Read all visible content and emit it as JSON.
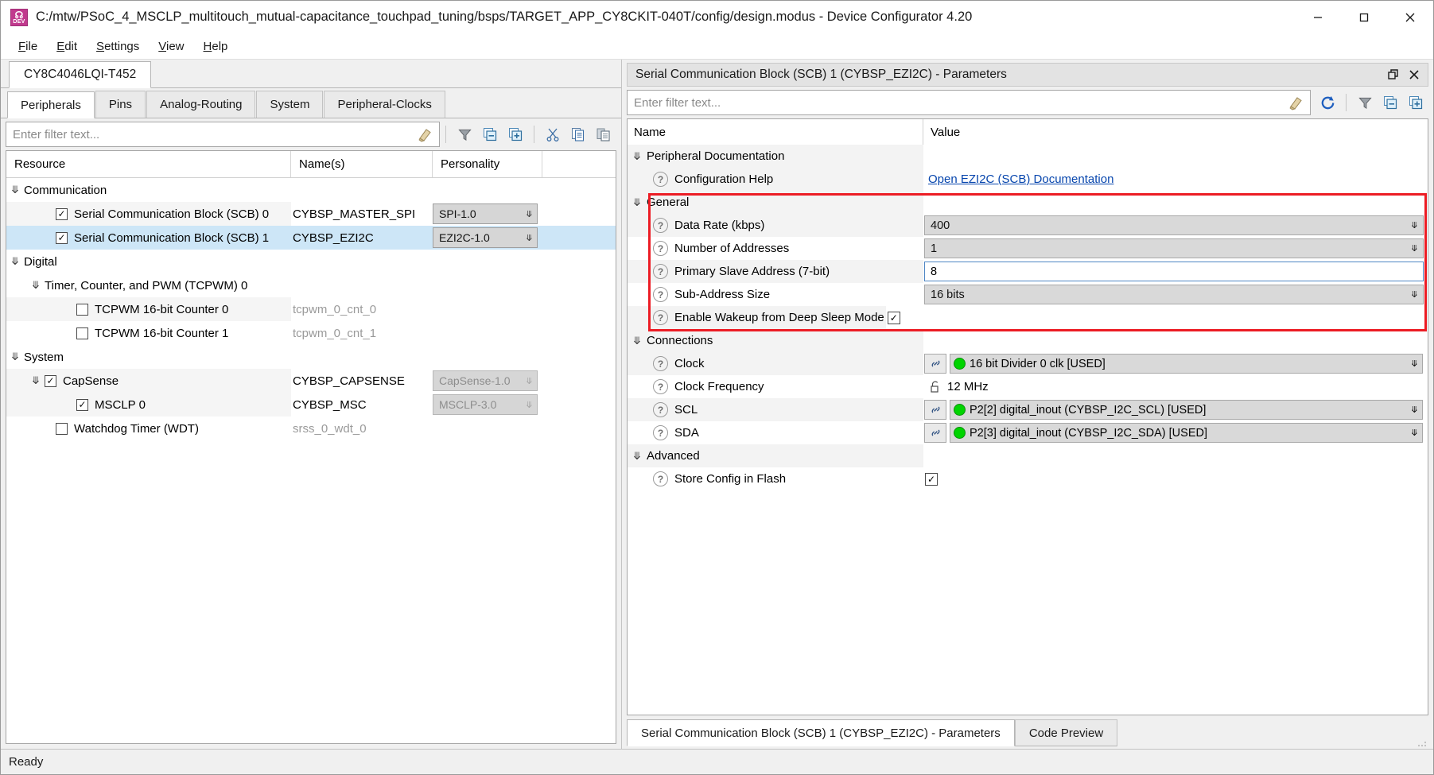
{
  "window": {
    "title": "C:/mtw/PSoC_4_MSCLP_multitouch_mutual-capacitance_touchpad_tuning/bsps/TARGET_APP_CY8CKIT-040T/config/design.modus - Device Configurator 4.20",
    "app_icon_label": "DEV",
    "minimize_label": "—",
    "maximize_label": "☐",
    "close_label": "✕"
  },
  "menu": [
    {
      "label": "File",
      "mnemonic": "F"
    },
    {
      "label": "Edit",
      "mnemonic": "E"
    },
    {
      "label": "Settings",
      "mnemonic": "S"
    },
    {
      "label": "View",
      "mnemonic": "V"
    },
    {
      "label": "Help",
      "mnemonic": "H"
    }
  ],
  "left": {
    "device_tab": "CY8C4046LQI-T452",
    "tabs": [
      {
        "label": "Peripherals",
        "active": true
      },
      {
        "label": "Pins",
        "active": false
      },
      {
        "label": "Analog-Routing",
        "active": false
      },
      {
        "label": "System",
        "active": false
      },
      {
        "label": "Peripheral-Clocks",
        "active": false
      }
    ],
    "filter_placeholder": "Enter filter text...",
    "toolbar": [
      {
        "name": "clear-filter-icon",
        "title": "Clear filter"
      },
      {
        "name": "filter-icon",
        "title": "Filter"
      },
      {
        "name": "collapse-all-icon",
        "title": "Collapse All"
      },
      {
        "name": "expand-all-icon",
        "title": "Expand All"
      },
      {
        "name": "cut-icon",
        "title": "Cut"
      },
      {
        "name": "copy-icon",
        "title": "Copy"
      },
      {
        "name": "paste-icon",
        "title": "Paste"
      }
    ],
    "columns": [
      "Resource",
      "Name(s)",
      "Personality",
      ""
    ],
    "rows": [
      {
        "kind": "group",
        "depth": 0,
        "expanded": true,
        "resource": "Communication",
        "name": "",
        "personality": null,
        "checkbox": null,
        "shade": false,
        "selected": false
      },
      {
        "kind": "item",
        "depth": 2,
        "expanded": null,
        "resource": "Serial Communication Block (SCB) 0",
        "name": "CYBSP_MASTER_SPI",
        "personality": "SPI-1.0",
        "personality_disabled": false,
        "checkbox": true,
        "shade": true,
        "selected": false
      },
      {
        "kind": "item",
        "depth": 2,
        "expanded": null,
        "resource": "Serial Communication Block (SCB) 1",
        "name": "CYBSP_EZI2C",
        "personality": "EZI2C-1.0",
        "personality_disabled": false,
        "checkbox": true,
        "shade": true,
        "selected": true
      },
      {
        "kind": "group",
        "depth": 0,
        "expanded": true,
        "resource": "Digital",
        "name": "",
        "personality": null,
        "checkbox": null,
        "shade": false,
        "selected": false
      },
      {
        "kind": "group",
        "depth": 1,
        "expanded": true,
        "resource": "Timer, Counter, and PWM (TCPWM) 0",
        "name": "",
        "personality": null,
        "checkbox": null,
        "shade": false,
        "selected": false
      },
      {
        "kind": "item",
        "depth": 2,
        "expanded": null,
        "resource": "TCPWM 16-bit Counter 0",
        "name": "tcpwm_0_cnt_0",
        "name_muted": true,
        "personality": null,
        "checkbox": false,
        "shade": true,
        "selected": false
      },
      {
        "kind": "item",
        "depth": 2,
        "expanded": null,
        "resource": "TCPWM 16-bit Counter 1",
        "name": "tcpwm_0_cnt_1",
        "name_muted": true,
        "personality": null,
        "checkbox": false,
        "shade": false,
        "selected": false
      },
      {
        "kind": "group",
        "depth": 0,
        "expanded": true,
        "resource": "System",
        "name": "",
        "personality": null,
        "checkbox": null,
        "shade": false,
        "selected": false
      },
      {
        "kind": "item",
        "depth": 1,
        "expanded": true,
        "resource": "CapSense",
        "name": "CYBSP_CAPSENSE",
        "personality": "CapSense-1.0",
        "personality_disabled": true,
        "checkbox": true,
        "shade": true,
        "selected": false
      },
      {
        "kind": "item",
        "depth": 2,
        "expanded": null,
        "resource": "MSCLP 0",
        "name": "CYBSP_MSC",
        "personality": "MSCLP-3.0",
        "personality_disabled": true,
        "checkbox": true,
        "shade": true,
        "selected": false
      },
      {
        "kind": "item",
        "depth": 1,
        "expanded": null,
        "resource": "Watchdog Timer (WDT)",
        "name": "srss_0_wdt_0",
        "name_muted": true,
        "personality": null,
        "checkbox": false,
        "shade": false,
        "selected": false
      }
    ]
  },
  "right": {
    "panel_title": "Serial Communication Block (SCB) 1 (CYBSP_EZI2C) - Parameters",
    "restore_label": "❐",
    "close_label": "✕",
    "filter_placeholder": "Enter filter text...",
    "toolbar": [
      {
        "name": "clear-filter-icon",
        "title": "Clear filter"
      },
      {
        "name": "refresh-icon",
        "title": "Refresh"
      },
      {
        "name": "filter-icon",
        "title": "Filter"
      },
      {
        "name": "collapse-all-icon",
        "title": "Collapse All"
      },
      {
        "name": "expand-all-icon",
        "title": "Expand All"
      }
    ],
    "columns": [
      "Name",
      "Value"
    ],
    "groups": [
      {
        "label": "Peripheral Documentation",
        "expanded": true,
        "highlighted": false,
        "params": [
          {
            "label": "Configuration Help",
            "type": "link",
            "value": "Open EZI2C (SCB) Documentation",
            "shade": true
          }
        ]
      },
      {
        "label": "General",
        "expanded": true,
        "highlighted": true,
        "params": [
          {
            "label": "Data Rate (kbps)",
            "type": "combo",
            "value": "400",
            "shade": true
          },
          {
            "label": "Number of Addresses",
            "type": "combo",
            "value": "1",
            "shade": false
          },
          {
            "label": "Primary Slave Address (7-bit)",
            "type": "text",
            "value": "8",
            "shade": true
          },
          {
            "label": "Sub-Address Size",
            "type": "combo",
            "value": "16 bits",
            "shade": false
          },
          {
            "label": "Enable Wakeup from Deep Sleep Mode",
            "type": "checkbox",
            "value": true,
            "shade": true
          }
        ]
      },
      {
        "label": "Connections",
        "expanded": true,
        "highlighted": false,
        "params": [
          {
            "label": "Clock",
            "type": "connection",
            "value": "16 bit Divider 0 clk [USED]",
            "status_color": "#00d400",
            "shade": true
          },
          {
            "label": "Clock Frequency",
            "type": "locked",
            "value": "12 MHz",
            "shade": false
          },
          {
            "label": "SCL",
            "type": "connection",
            "value": "P2[2] digital_inout (CYBSP_I2C_SCL) [USED]",
            "status_color": "#00d400",
            "shade": true
          },
          {
            "label": "SDA",
            "type": "connection",
            "value": "P2[3] digital_inout (CYBSP_I2C_SDA) [USED]",
            "status_color": "#00d400",
            "shade": false
          }
        ]
      },
      {
        "label": "Advanced",
        "expanded": true,
        "highlighted": false,
        "params": [
          {
            "label": "Store Config in Flash",
            "type": "checkbox",
            "value": true,
            "shade": false
          }
        ]
      }
    ],
    "bottom_tabs": [
      {
        "label": "Serial Communication Block (SCB) 1 (CYBSP_EZI2C) - Parameters",
        "active": true
      },
      {
        "label": "Code Preview",
        "active": false
      }
    ]
  },
  "status": {
    "text": "Ready"
  },
  "colors": {
    "highlight_red": "#ec1c24",
    "selection_blue": "#cde6f7",
    "link_blue": "#0645ad",
    "status_green": "#00d400"
  }
}
